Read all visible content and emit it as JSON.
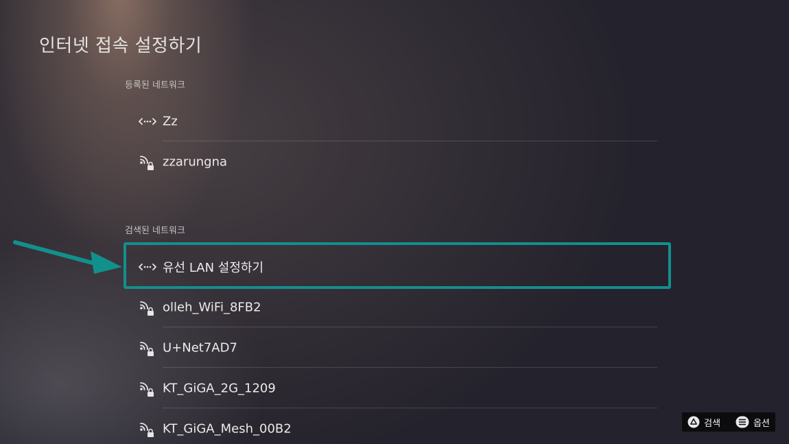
{
  "page": {
    "title": "인터넷 접속 설정하기"
  },
  "registered": {
    "header": "등록된 네트워크",
    "items": [
      {
        "label": "Zz",
        "icon": "wired-lan-icon"
      },
      {
        "label": "zzarungna",
        "icon": "wifi-locked-icon"
      }
    ]
  },
  "scanned": {
    "header": "검색된 네트워크",
    "items": [
      {
        "label": "유선 LAN 설정하기",
        "icon": "wired-lan-icon",
        "highlighted": true
      },
      {
        "label": "olleh_WiFi_8FB2",
        "icon": "wifi-locked-icon"
      },
      {
        "label": "U+Net7AD7",
        "icon": "wifi-locked-icon"
      },
      {
        "label": "KT_GiGA_2G_1209",
        "icon": "wifi-locked-icon"
      },
      {
        "label": "KT_GiGA_Mesh_00B2",
        "icon": "wifi-locked-icon"
      }
    ]
  },
  "footer": {
    "search_label": "검색",
    "search_icon": "triangle-button-icon",
    "options_label": "옵션",
    "options_icon": "options-button-icon"
  },
  "colors": {
    "highlight": "#12908c",
    "arrow": "#12908c"
  }
}
